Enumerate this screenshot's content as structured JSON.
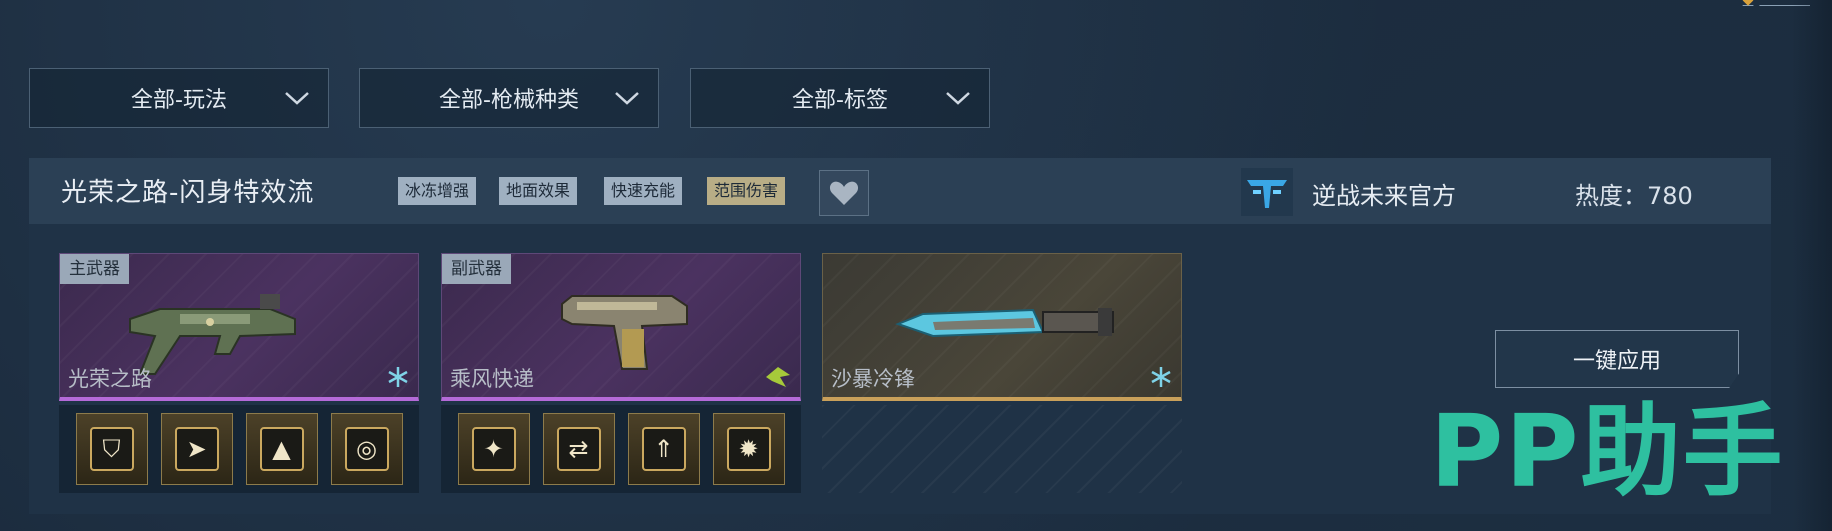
{
  "filters": [
    {
      "label": "全部-玩法"
    },
    {
      "label": "全部-枪械种类"
    },
    {
      "label": "全部-标签"
    }
  ],
  "loadout": {
    "title": "光荣之路-闪身特效流",
    "tags": [
      "冰冻增强",
      "地面效果",
      "快速充能",
      "范围伤害"
    ],
    "author": "逆战未来官方",
    "heat": "热度：780",
    "apply_label": "一键应用",
    "weapons": [
      {
        "slot": "主武器",
        "name": "光荣之路",
        "rarity_color": "#b56ad8",
        "element_icon": "snowflake-icon"
      },
      {
        "slot": "副武器",
        "name": "乘风快递",
        "rarity_color": "#b56ad8",
        "element_icon": "lightning-icon"
      },
      {
        "slot": "",
        "name": "沙暴冷锋",
        "rarity_color": "#c9a05a",
        "element_icon": "snowflake-icon"
      }
    ],
    "mods": [
      [
        "shield-mod-icon",
        "arrow-mod-icon",
        "spike-mod-icon",
        "target-mod-icon"
      ],
      [
        "burst-mod-icon",
        "swap-mod-icon",
        "up-arrow-mod-icon",
        "star-mod-icon"
      ]
    ]
  },
  "watermark": "PP助手",
  "colors": {
    "background": "#1b2b3d",
    "card": "#1f3246",
    "accent_teal": "#2ec0a0",
    "purple_rarity": "#b56ad8",
    "gold_rarity": "#c9a05a"
  }
}
